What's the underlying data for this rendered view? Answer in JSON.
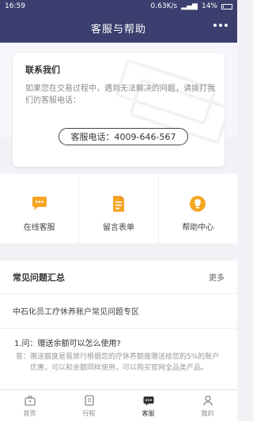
{
  "status_bar": {
    "time": "16:59",
    "network_speed": "0.63K/s",
    "battery": "14%"
  },
  "header": {
    "title": "客服与帮助",
    "more_icon": "more-dots-icon"
  },
  "contact": {
    "title": "联系我们",
    "description": "如果您在交易过程中，遇到无法解决的问题，请拨打我们的客服电话：",
    "phone_label": "客服电话：4009-646-567"
  },
  "services": [
    {
      "label": "在线客服",
      "icon": "chat-bubble-icon"
    },
    {
      "label": "留言表单",
      "icon": "document-edit-icon"
    },
    {
      "label": "帮助中心",
      "icon": "lightbulb-icon"
    }
  ],
  "faq": {
    "title": "常见问题汇总",
    "more_label": "更多",
    "section_label": "中石化员工疗休养账户常见问题专区",
    "items": [
      {
        "question": "1.问：赠送余额可以怎么使用?",
        "answer_label": "答：",
        "answer": "赠送额度是易旅行根据您的疗休养额度赠送给您的5%的账户优惠，可以和余额同样使用，可以购买官网全品类产品。"
      }
    ]
  },
  "tab_bar": {
    "items": [
      {
        "label": "首页",
        "icon": "home-briefcase-icon",
        "active": false
      },
      {
        "label": "行程",
        "icon": "itinerary-icon",
        "active": false
      },
      {
        "label": "客服",
        "icon": "customer-service-icon",
        "active": true
      },
      {
        "label": "我的",
        "icon": "profile-icon",
        "active": false
      }
    ]
  },
  "colors": {
    "header_bg": "#3b3f6f",
    "accent_orange": "#f5a623",
    "tab_active": "#333333",
    "tab_inactive": "#8a8a8a"
  }
}
